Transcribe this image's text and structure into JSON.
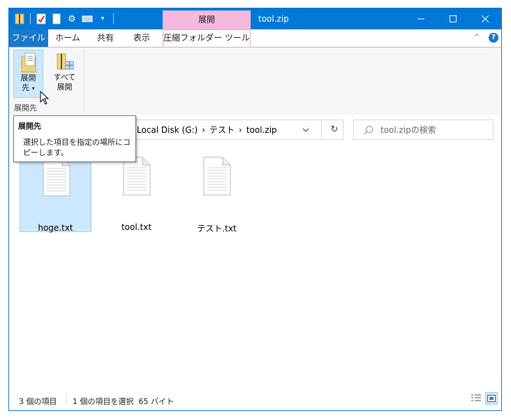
{
  "window": {
    "title": "tool.zip",
    "context_tab_header": "展開",
    "controls": {
      "minimize": "minimize",
      "maximize": "maximize",
      "close": "close"
    }
  },
  "quick_access": [
    "zip-folder-icon",
    "properties-check-icon",
    "new-document-icon",
    "settings-gear-icon",
    "rename-icon",
    "customize-dropdown-icon"
  ],
  "tabs": [
    {
      "label": "ファイル"
    },
    {
      "label": "ホーム"
    },
    {
      "label": "共有"
    },
    {
      "label": "表示"
    },
    {
      "label": "圧縮フォルダー ツール"
    }
  ],
  "ribbon": {
    "extract_to": {
      "line1": "展開",
      "line2": "先"
    },
    "extract_all": {
      "line1": "すべて",
      "line2": "展開"
    },
    "group_label": "展開先"
  },
  "tooltip": {
    "title": "展開先",
    "description_line1": "選択した項目を指定の場所にコ",
    "description_line2": "ピーします。"
  },
  "address": {
    "crumbs": [
      "Local Disk (G:)",
      "テスト",
      "tool.zip"
    ],
    "separator": "›"
  },
  "search": {
    "placeholder": "tool.zipの検索"
  },
  "files": [
    {
      "name": "hoge.txt",
      "selected": true
    },
    {
      "name": "tool.txt",
      "selected": false
    },
    {
      "name": "テスト.txt",
      "selected": false
    }
  ],
  "status": {
    "item_count": "3 個の項目",
    "selection": "1 個の項目を選択  65 バイト"
  },
  "colors": {
    "titlebar": "#0078d7",
    "context_tab": "#f5b9dd",
    "selection": "#cce8ff",
    "file_tab": "#1979ca"
  }
}
